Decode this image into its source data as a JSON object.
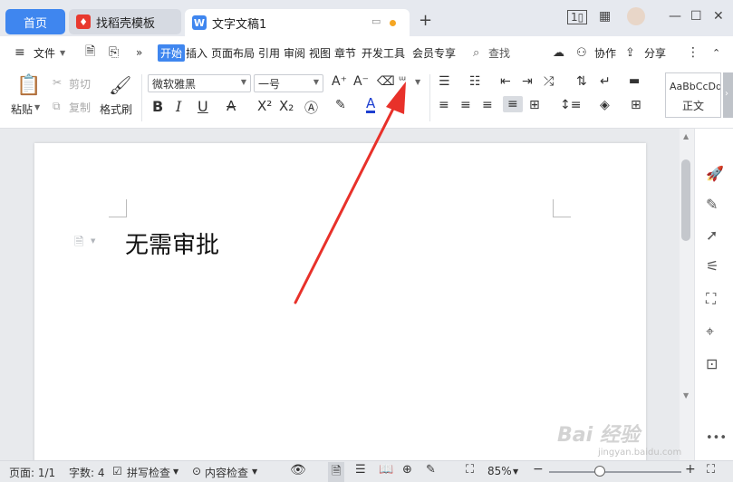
{
  "tabs": {
    "home": "首页",
    "template": "找稻壳模板",
    "doc": "文字文稿1"
  },
  "menu": {
    "file": "文件",
    "items": [
      "开始",
      "插入",
      "页面布局",
      "引用",
      "审阅",
      "视图",
      "章节",
      "开发工具",
      "会员专享"
    ],
    "search": "查找",
    "collab": "协作",
    "share": "分享"
  },
  "ribbon": {
    "paste": "粘贴",
    "cut": "剪切",
    "copy": "复制",
    "format_painter": "格式刷",
    "font_name": "微软雅黑",
    "font_size": "一号",
    "style_preview": "AaBbCcDd",
    "style_name": "正文"
  },
  "document": {
    "text": "无需审批"
  },
  "status": {
    "page": "页面: 1/1",
    "words": "字数: 4",
    "spell": "拼写检查",
    "content": "内容检查",
    "zoom": "85%"
  },
  "watermark": {
    "text": "Bai 经验",
    "url": "jingyan.baidu.com"
  },
  "colors": {
    "accent": "#3f86ef",
    "arrow": "#e8312a"
  }
}
